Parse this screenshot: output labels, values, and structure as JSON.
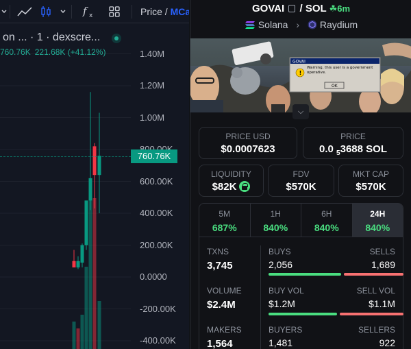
{
  "toolbar": {
    "price_label": "Price / ",
    "mcap_label": "MCa"
  },
  "chart": {
    "title": "on ... · 1 · dexscre...",
    "legend_close": "760.76K",
    "legend_change": "221.68K (+41.12%)",
    "current_price_tag": "760.76K",
    "y_ticks": [
      "1.40M",
      "1.20M",
      "1.00M",
      "800.00K",
      "600.00K",
      "400.00K",
      "200.00K",
      "0.0000",
      "-200.00K",
      "-400.00K"
    ]
  },
  "chart_data": {
    "type": "candlestick",
    "y_ticks": [
      1400000,
      1200000,
      1000000,
      800000,
      600000,
      400000,
      200000,
      0,
      -200000,
      -400000
    ],
    "ylim": [
      -400000,
      1400000
    ],
    "last_value": 760760,
    "candles": [
      {
        "open": 100000,
        "high": 170000,
        "low": 60000,
        "close": 60000
      },
      {
        "open": 60000,
        "high": 130000,
        "low": 50000,
        "close": 100000
      },
      {
        "open": 90000,
        "high": 210000,
        "low": 60000,
        "close": 200000
      },
      {
        "open": 200000,
        "high": 440000,
        "low": 170000,
        "close": 480000
      },
      {
        "open": 480000,
        "high": 1160000,
        "low": 420000,
        "close": 620000
      },
      {
        "open": 820000,
        "high": 840000,
        "low": 430000,
        "close": 640000
      },
      {
        "open": 640000,
        "high": 1030000,
        "low": 400000,
        "close": 760760
      }
    ],
    "volumes": [
      {
        "value": 40,
        "up": true
      },
      {
        "value": 30,
        "up": false
      },
      {
        "value": 50,
        "up": true
      },
      {
        "value": 120,
        "up": true
      },
      {
        "value": 240,
        "up": true
      },
      {
        "value": 220,
        "up": false
      },
      {
        "value": 70,
        "up": true
      }
    ]
  },
  "token": {
    "symbol": "GOVAI",
    "quote": "/ SOL",
    "age": "6m",
    "chain": "Solana",
    "dex": "Raydium"
  },
  "banner": {
    "dialog_title": "GOVAI",
    "dialog_text": "Warning, this user is a government operative.",
    "dialog_button": "OK"
  },
  "metrics": {
    "price_usd_label": "PRICE USD",
    "price_usd": "$0.0007623",
    "price_label": "PRICE",
    "price_sol_prefix": "0.0",
    "price_sol_sub": "5",
    "price_sol_rest": "3688 SOL",
    "liquidity_label": "LIQUIDITY",
    "liquidity": "$82K",
    "fdv_label": "FDV",
    "fdv": "$570K",
    "mktcap_label": "MKT CAP",
    "mktcap": "$570K"
  },
  "timeframes": [
    {
      "label": "5M",
      "value": "687%"
    },
    {
      "label": "1H",
      "value": "840%"
    },
    {
      "label": "6H",
      "value": "840%"
    },
    {
      "label": "24H",
      "value": "840%"
    }
  ],
  "stats": {
    "txns_label": "TXNS",
    "txns": "3,745",
    "buys_label": "BUYS",
    "buys": "2,056",
    "sells_label": "SELLS",
    "sells": "1,689",
    "volume_label": "VOLUME",
    "volume": "$2.4M",
    "buy_vol_label": "BUY VOL",
    "buy_vol": "$1.2M",
    "sell_vol_label": "SELL VOL",
    "sell_vol": "$1.1M",
    "makers_label": "MAKERS",
    "makers": "1,564",
    "buyers_label": "BUYERS",
    "buyers": "1,481",
    "sellers_label": "SELLERS",
    "sellers": "922",
    "buys_ratio": 0.55,
    "buy_vol_ratio": 0.52
  },
  "colors": {
    "up": "#089981",
    "down": "#f23645",
    "accent_green": "#4ade80",
    "sell_red": "#f87171"
  }
}
